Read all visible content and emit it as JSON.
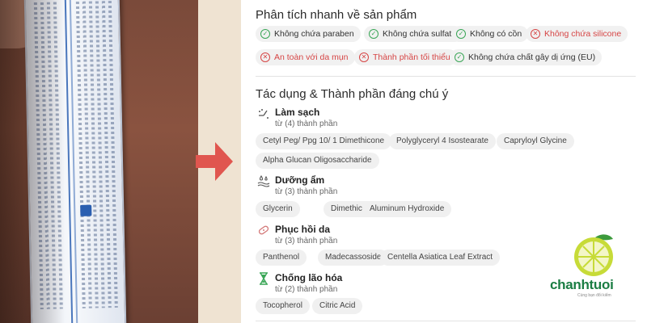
{
  "quick": {
    "title": "Phân tích nhanh về sản phẩm",
    "chips": [
      {
        "label": "Không chứa paraben",
        "status": "ok"
      },
      {
        "label": "Không chứa sulfate",
        "status": "ok"
      },
      {
        "label": "Không có cồn",
        "status": "ok"
      },
      {
        "label": "Không chứa silicone",
        "status": "bad"
      },
      {
        "label": "An toàn với da mụn",
        "status": "bad"
      },
      {
        "label": "Thành phần tối thiểu",
        "status": "bad"
      },
      {
        "label": "Không chứa chất gây dị ứng (EU)",
        "status": "ok"
      }
    ]
  },
  "effects": {
    "title": "Tác dụng & Thành phần đáng chú ý",
    "categories": [
      {
        "name": "Làm sạch",
        "count": "từ (4) thành phần",
        "tags": [
          "Cetyl Peg/ Ppg 10/ 1 Dimethicone",
          "Polyglyceryl 4 Isostearate",
          "Capryloyl Glycine",
          "Alpha Glucan Oligosaccharide"
        ]
      },
      {
        "name": "Dưỡng ẩm",
        "count": "từ (3) thành phần",
        "tags": [
          "Glycerin",
          "Dimethicone",
          "Aluminum Hydroxide"
        ]
      },
      {
        "name": "Phục hồi da",
        "count": "từ (3) thành phần",
        "tags": [
          "Panthenol",
          "Madecassoside",
          "Centella Asiatica Leaf Extract"
        ]
      },
      {
        "name": "Chống lão hóa",
        "count": "từ (2) thành phần",
        "tags": [
          "Tocopherol",
          "Citric Acid"
        ]
      }
    ]
  },
  "brand": {
    "name": "chanhtuoi",
    "tagline": "Cùng bạn đổi kiểm"
  },
  "colors": {
    "ok": "#3aa657",
    "bad": "#d64545",
    "arrow": "#e0564f",
    "brand": "#1a7d43"
  },
  "icons": {
    "ok": "check-circle-icon",
    "bad": "x-circle-icon"
  }
}
